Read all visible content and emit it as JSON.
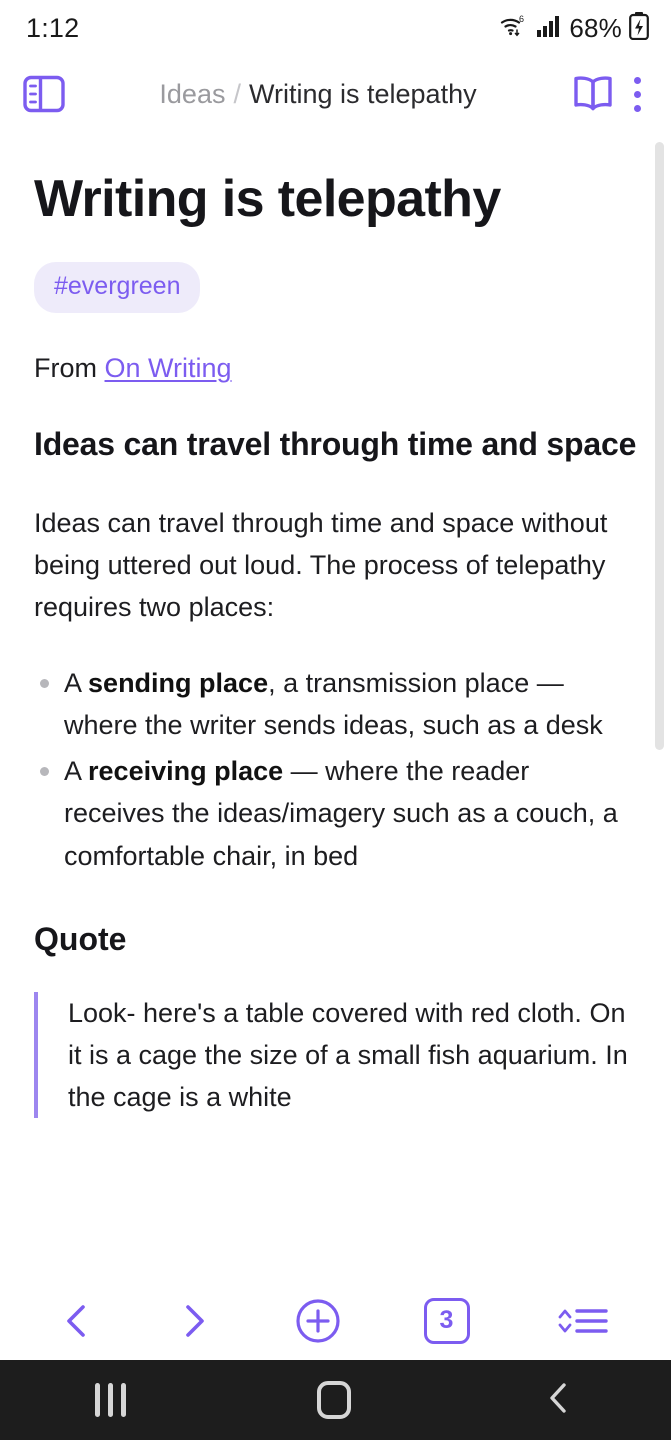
{
  "status_bar": {
    "time": "1:12",
    "wifi_icon": "wifi-6-icon",
    "signal_icon": "cellular-signal-icon",
    "battery_percent": "68%",
    "battery_icon": "battery-charging-icon"
  },
  "app_bar": {
    "sidebar_toggle_icon": "sidebar-toggle-icon",
    "breadcrumb": {
      "parent": "Ideas",
      "separator": "/",
      "current": "Writing is telepathy"
    },
    "reading_mode_icon": "open-book-icon",
    "more_menu_icon": "kebab-menu-icon"
  },
  "note": {
    "title": "Writing is telepathy",
    "tags": [
      "#evergreen"
    ],
    "from_label": "From",
    "from_link": "On Writing",
    "section_heading": "Ideas can travel through time and space",
    "paragraph": "Ideas can travel through time and space without being uttered out loud. The process of telepathy requires two places:",
    "bullets": [
      {
        "lead": "A ",
        "bold": "sending place",
        "rest": ", a transmission place — where the writer sends ideas, such as a desk"
      },
      {
        "lead": "A ",
        "bold": "receiving place",
        "rest": " — where the reader receives the ideas/imagery such as a couch, a comfortable chair, in bed"
      }
    ],
    "quote_heading": "Quote",
    "quote_text": "Look- here's a table covered with red cloth. On it is a cage the size of a small fish aquarium. In the cage is a white"
  },
  "toolbar": {
    "back_icon": "chevron-left-icon",
    "forward_icon": "chevron-right-icon",
    "add_icon": "plus-circle-icon",
    "tab_count": "3",
    "outline_icon": "outline-sort-icon"
  },
  "nav_bar": {
    "recents_icon": "recents-icon",
    "home_icon": "home-icon",
    "back_icon": "android-back-icon"
  },
  "colors": {
    "accent": "#7c5cf0",
    "tag_bg": "#eeebfa",
    "quote_border": "#9d86ef",
    "text": "#1d1d20",
    "muted": "#9a9a9e",
    "nav_bg": "#1d1d1d"
  }
}
